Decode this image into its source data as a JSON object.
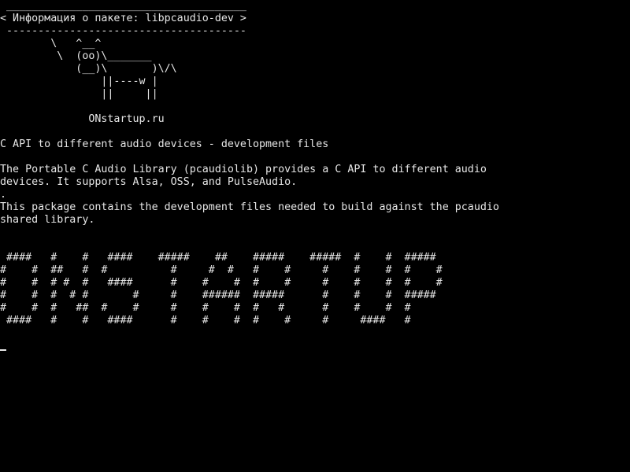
{
  "terminal": {
    "colors": {
      "background": "#000000",
      "foreground": "#e6e6e6"
    },
    "lines": [
      " ______________________________________",
      "< Информация о пакете: libpcaudio-dev >",
      " --------------------------------------",
      "        \\   ^__^",
      "         \\  (oo)\\_______",
      "            (__)\\       )\\/\\",
      "                ||----w |",
      "                ||     ||",
      "",
      "              ONstartup.ru",
      "",
      "C API to different audio devices - development files",
      "",
      "The Portable C Audio Library (pcaudiolib) provides a C API to different audio",
      "devices. It supports Alsa, OSS, and PulseAudio.",
      ".",
      "This package contains the development files needed to build against the pcaudio",
      "shared library.",
      "",
      "",
      " ####   #    #   ####    #####    ##    #####    #####  #    #  #####",
      "#    #  ##   #  #          #     #  #   #    #     #    #    #  #    #",
      "#    #  # #  #   ####      #    #    #  #    #     #    #    #  #    #",
      "#    #  #  # #       #     #    ######  #####      #    #    #  #####",
      "#    #  #   ##  #    #     #    #    #  #   #      #    #    #  #",
      " ####   #    #   ####      #    #    #  #    #     #     ####   #"
    ]
  }
}
